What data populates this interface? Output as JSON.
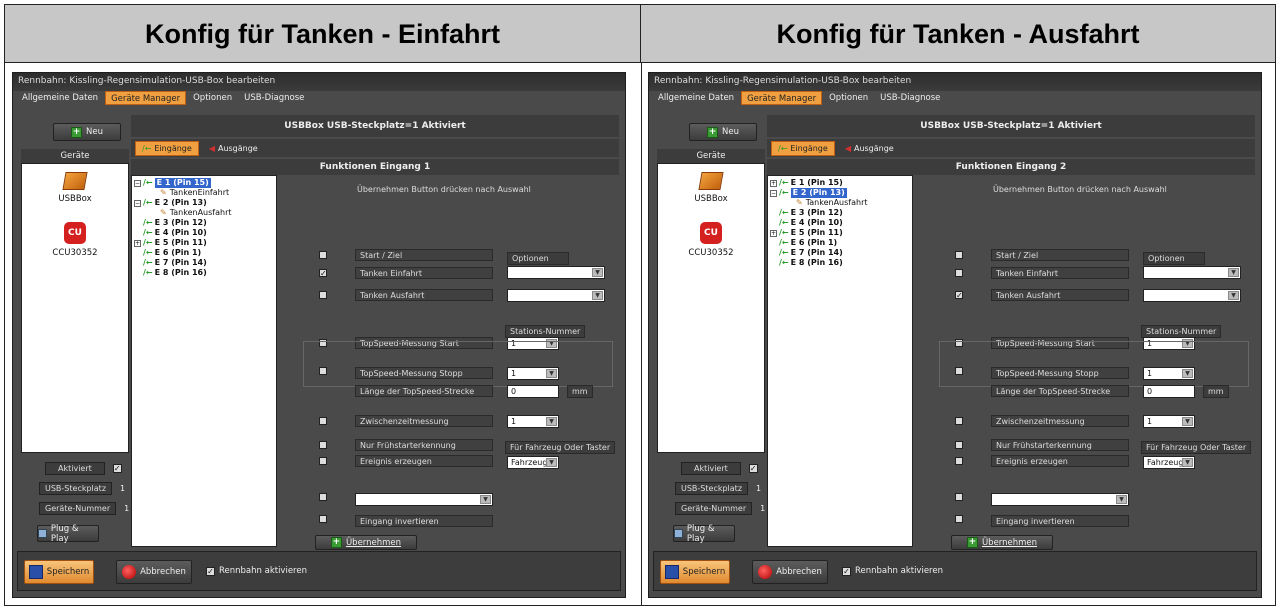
{
  "headers": {
    "left": "Konfig für Tanken - Einfahrt",
    "right": "Konfig für Tanken - Ausfahrt"
  },
  "window": {
    "title": "Rennbahn: Kissling-Regensimulation-USB-Box bearbeiten",
    "menu": [
      "Allgemeine Daten",
      "Geräte Manager",
      "Optionen",
      "USB-Diagnose"
    ],
    "active_menu": "Geräte Manager",
    "new_button": "Neu",
    "devices_label": "Geräte",
    "devices": [
      {
        "name": "USBBox",
        "icon": "usb-box-icon"
      },
      {
        "name": "CCU30352",
        "icon": "cu-controller-icon"
      }
    ],
    "aktiviert_label": "Aktiviert",
    "aktiviert_checked": "✓",
    "usb_steckplatz_label": "USB-Steckplatz",
    "usb_steckplatz_value": "1",
    "geraete_nummer_label": "Geräte-Nummer",
    "geraete_nummer_value": "1",
    "plug_play": "Plug & Play",
    "usb_header": "USBBox  USB-Steckplatz=1  Aktiviert",
    "tab_inputs": "Eingänge",
    "tab_outputs": "Ausgänge",
    "note": "Übernehmen Button drücken nach Auswahl",
    "optionen_button": "Optionen",
    "stations_nummer": "Stations-Nummer",
    "labels": {
      "start_ziel": "Start / Ziel",
      "tanken_einfahrt": "Tanken Einfahrt",
      "tanken_ausfahrt": "Tanken Ausfahrt",
      "topspeed_start": "TopSpeed-Messung Start",
      "topspeed_stopp": "TopSpeed-Messung Stopp",
      "laenge": "Länge der TopSpeed-Strecke",
      "zwischenzeit": "Zwischenzeitmessung",
      "nur_fruehstart": "Nur Frühstarterkennung",
      "ereignis": "Ereignis erzeugen",
      "eingang_invertieren": "Eingang invertieren"
    },
    "combo_values": {
      "topspeed_start": "1",
      "topspeed_stopp": "1",
      "laenge": "0",
      "zwischenzeit": "1",
      "fahrzeug": "Fahrzeug"
    },
    "unit_mm": "mm",
    "fuer_fahrzeug": "Für Fahrzeug Oder Taster",
    "uebernehmen": "Übernehmen",
    "speichern": "Speichern",
    "abbrechen": "Abbrechen",
    "rennbahn_aktivieren": "Rennbahn aktivieren",
    "checkmark": "✓"
  },
  "panels": [
    {
      "func_header": "Funktionen Eingang 1",
      "checked": "tanken_einfahrt",
      "tree": [
        {
          "label": "E 1 (Pin 15)",
          "exp": "⊟",
          "selected": true
        },
        {
          "label": "TankenEinfahrt",
          "child": true
        },
        {
          "label": "E 2 (Pin 13)",
          "exp": "⊟"
        },
        {
          "label": "TankenAusfahrt",
          "child": true
        },
        {
          "label": "E 3 (Pin 12)"
        },
        {
          "label": "E 4 (Pin 10)"
        },
        {
          "label": "E 5 (Pin 11)",
          "exp": "⊞"
        },
        {
          "label": "E 6 (Pin 1)"
        },
        {
          "label": "E 7 (Pin 14)"
        },
        {
          "label": "E 8 (Pin 16)"
        }
      ]
    },
    {
      "func_header": "Funktionen Eingang 2",
      "checked": "tanken_ausfahrt",
      "tree": [
        {
          "label": "E 1 (Pin 15)",
          "exp": "⊞"
        },
        {
          "label": "E 2 (Pin 13)",
          "exp": "⊟",
          "selected": true
        },
        {
          "label": "TankenAusfahrt",
          "child": true
        },
        {
          "label": "E 3 (Pin 12)"
        },
        {
          "label": "E 4 (Pin 10)"
        },
        {
          "label": "E 5 (Pin 11)",
          "exp": "⊞"
        },
        {
          "label": "E 6 (Pin 1)"
        },
        {
          "label": "E 7 (Pin 14)"
        },
        {
          "label": "E 8 (Pin 16)"
        }
      ]
    }
  ]
}
